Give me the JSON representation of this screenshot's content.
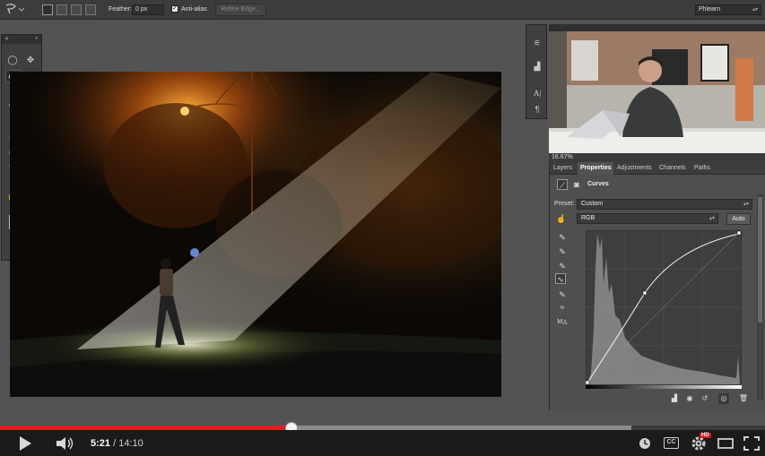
{
  "options_bar": {
    "feather_label": "Feather:",
    "feather_value": "0 px",
    "antialias_label": "Anti-alias",
    "antialias_checked": "✓",
    "refine_edge_label": "Refine Edge...",
    "workspace_value": "Phlearn"
  },
  "properties": {
    "tabs": [
      "Layers",
      "Properties",
      "Adjustments",
      "Channels",
      "Paths"
    ],
    "active_tab": "Properties",
    "panel_title": "Curves",
    "preset_label": "Preset:",
    "preset_value": "Custom",
    "channel_value": "RGB",
    "auto_label": "Auto"
  },
  "video_panel": {
    "zoom_level": "16.67%"
  },
  "player": {
    "current_time": "5:21",
    "separator": " / ",
    "total_time": "14:10",
    "progress_fraction": 0.381,
    "buffered_fraction": 0.825,
    "hd_label": "HD",
    "cc_label": "CC"
  },
  "colors": {
    "progress_red": "#e02020",
    "panel_bg": "#535353",
    "accent_orange": "#e88a2a"
  }
}
